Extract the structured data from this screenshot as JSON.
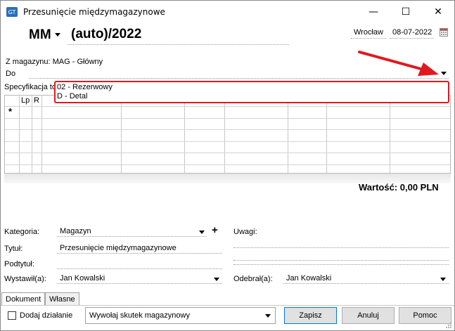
{
  "window": {
    "title": "Przesunięcie międzymagazynowe",
    "minimize": "—",
    "maximize": "☐",
    "close": "✕"
  },
  "document": {
    "type": "MM",
    "number": "(auto)/2022",
    "place": "Wrocław",
    "date": "08-07-2022"
  },
  "header": {
    "from_warehouse": "Z magazynu: MAG - Główny",
    "to_label": "Do",
    "spec_label": "Specyfikacja to"
  },
  "dropdown": {
    "options": [
      "02 - Rezerwowy",
      "D - Detal"
    ]
  },
  "grid": {
    "columns": [
      "Lp",
      "R"
    ],
    "new_row_marker": "*"
  },
  "summary": {
    "value": "Wartość: 0,00 PLN"
  },
  "form": {
    "category_label": "Kategoria:",
    "category_value": "Magazyn",
    "plus": "+",
    "remarks_label": "Uwagi:",
    "title_label": "Tytuł:",
    "title_value": "Przesunięcie międzymagazynowe",
    "subtitle_label": "Podtytuł:",
    "issued_label": "Wystawił(a):",
    "issued_value": "Jan Kowalski",
    "received_label": "Odebrał(a):",
    "received_value": "Jan Kowalski"
  },
  "tabs": [
    "Dokument",
    "Własne"
  ],
  "footer": {
    "add_action": "Dodaj działanie",
    "action_select": "Wywołaj skutek magazynowy",
    "save": "Zapisz",
    "cancel": "Anuluj",
    "help": "Pomoc"
  },
  "colors": {
    "annotation_red": "#e0191f",
    "focus_blue": "#0078d7"
  }
}
